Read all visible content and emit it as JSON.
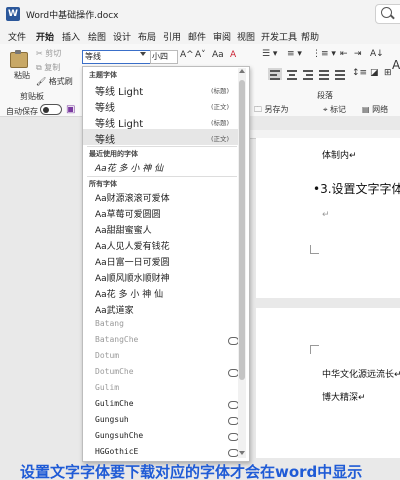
{
  "window": {
    "title": "Word中基础操作.docx",
    "app_icon": "W"
  },
  "menu": [
    "文件",
    "开始",
    "插入",
    "绘图",
    "设计",
    "布局",
    "引用",
    "邮件",
    "审阅",
    "视图",
    "开发工具",
    "帮助"
  ],
  "ribbon": {
    "paste": "粘贴",
    "cut": "剪切",
    "copy": "复制",
    "format_painter": "格式刷",
    "clipboard_group": "剪贴板",
    "font_name": "等线",
    "font_size": "小四",
    "grow": "A^",
    "shrink": "A˅",
    "aa": "Aa",
    "clear_format": "A",
    "autosave": "自动保存",
    "autosave_state": "关",
    "paragraph_group": "段落",
    "style_preview": "A",
    "save_as": "另存为",
    "bookmark": "标记",
    "share": "网络"
  },
  "dropdown": {
    "theme_header": "主题字体",
    "theme_fonts": [
      {
        "name": "等线 Light",
        "tag": "(标题)"
      },
      {
        "name": "等线",
        "tag": "(正文)"
      },
      {
        "name": "等线 Light",
        "tag": "(标题)"
      },
      {
        "name": "等线",
        "tag": "(正文)"
      }
    ],
    "recent_header": "最近使用的字体",
    "recent_fonts": [
      "Aa花 多 小 神 仙"
    ],
    "all_header": "所有字体",
    "all_fonts": [
      {
        "name": "Aa财源滚滚可爱体",
        "cloud": false,
        "gray": false
      },
      {
        "name": "Aa草莓可爱圆圆",
        "cloud": false,
        "gray": false
      },
      {
        "name": "Aa甜甜蜜蜜人",
        "cloud": false,
        "gray": false
      },
      {
        "name": "Aa人见人爱有钱花",
        "cloud": false,
        "gray": false
      },
      {
        "name": "Aa日富一日可爱圆",
        "cloud": false,
        "gray": false
      },
      {
        "name": "Aa顺风顺水顺财神",
        "cloud": false,
        "gray": false
      },
      {
        "name": "Aa花 多 小 神 仙",
        "cloud": false,
        "gray": false
      },
      {
        "name": "Aa武道家",
        "cloud": false,
        "gray": false
      },
      {
        "name": "Batang",
        "cloud": false,
        "gray": true
      },
      {
        "name": "BatangChe",
        "cloud": true,
        "gray": true
      },
      {
        "name": "Dotum",
        "cloud": false,
        "gray": true
      },
      {
        "name": "DotumChe",
        "cloud": true,
        "gray": true
      },
      {
        "name": "Gulim",
        "cloud": false,
        "gray": true
      },
      {
        "name": "GulimChe",
        "cloud": true,
        "gray": false
      },
      {
        "name": "Gungsuh",
        "cloud": true,
        "gray": false
      },
      {
        "name": "GungsuhChe",
        "cloud": true,
        "gray": false
      },
      {
        "name": "HGGothicE",
        "cloud": true,
        "gray": false
      }
    ]
  },
  "document": {
    "line1": "体制内↵",
    "line2": "•3.设置文字字体",
    "line3": "↵",
    "line4": "中华文化源远流长↵",
    "line5": "博大精深↵"
  },
  "caption": "设置文字字体要下载对应的字体才会在word中显示",
  "colors": {
    "accent": "#2b579a",
    "caption": "#1f5bd6",
    "highlight": "#e6e6e6"
  }
}
